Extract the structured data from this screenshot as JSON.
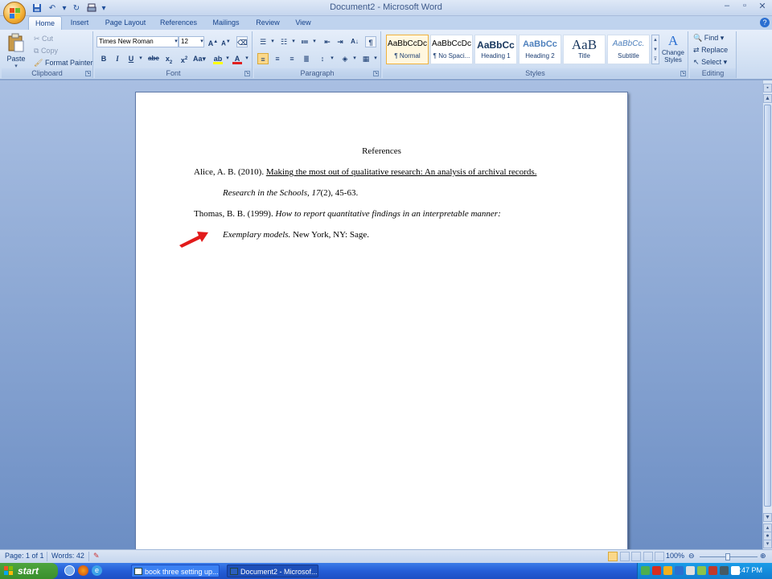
{
  "window": {
    "title": "Document2 - Microsoft Word"
  },
  "ribbon": {
    "tabs": [
      "Home",
      "Insert",
      "Page Layout",
      "References",
      "Mailings",
      "Review",
      "View"
    ],
    "clipboard": {
      "label": "Clipboard",
      "paste": "Paste",
      "cut": "Cut",
      "copy": "Copy",
      "format_painter": "Format Painter"
    },
    "font": {
      "label": "Font",
      "font_name": "Times New Roman",
      "font_size": "12",
      "font_color": "#e02020",
      "highlight_color": "#ffff00"
    },
    "paragraph": {
      "label": "Paragraph"
    },
    "styles": {
      "label": "Styles",
      "items": [
        {
          "sample": "AaBbCcDc",
          "name": "¶ Normal"
        },
        {
          "sample": "AaBbCcDc",
          "name": "¶ No Spaci..."
        },
        {
          "sample": "AaBbCc",
          "name": "Heading 1"
        },
        {
          "sample": "AaBbCc",
          "name": "Heading 2"
        },
        {
          "sample": "AaB",
          "name": "Title"
        },
        {
          "sample": "AaBbCc.",
          "name": "Subtitle"
        }
      ],
      "change_styles": "Change Styles"
    },
    "editing": {
      "label": "Editing",
      "find": "Find",
      "replace": "Replace",
      "select": "Select"
    }
  },
  "document": {
    "heading": "References",
    "entry1": {
      "author_year": "Alice, A. B. (2010).",
      "title": "Making the most out of qualitative research:  An analysis of archival records.",
      "journal": "Research in the Schools, 17",
      "issue_pages": "(2), 45-63."
    },
    "entry2": {
      "author_year": "Thomas, B. B. (1999).",
      "title_part1": "How to report quantitative findings in an interpretable manner:",
      "title_part2": "Exemplary models.",
      "publisher": "New York, NY: Sage."
    }
  },
  "statusbar": {
    "page": "Page: 1 of 1",
    "words": "Words: 42",
    "zoom": "100%"
  },
  "taskbar": {
    "start": "start",
    "tasks": [
      "book three setting up...",
      "Document2 - Microsof..."
    ],
    "clock": "2:47 PM"
  }
}
